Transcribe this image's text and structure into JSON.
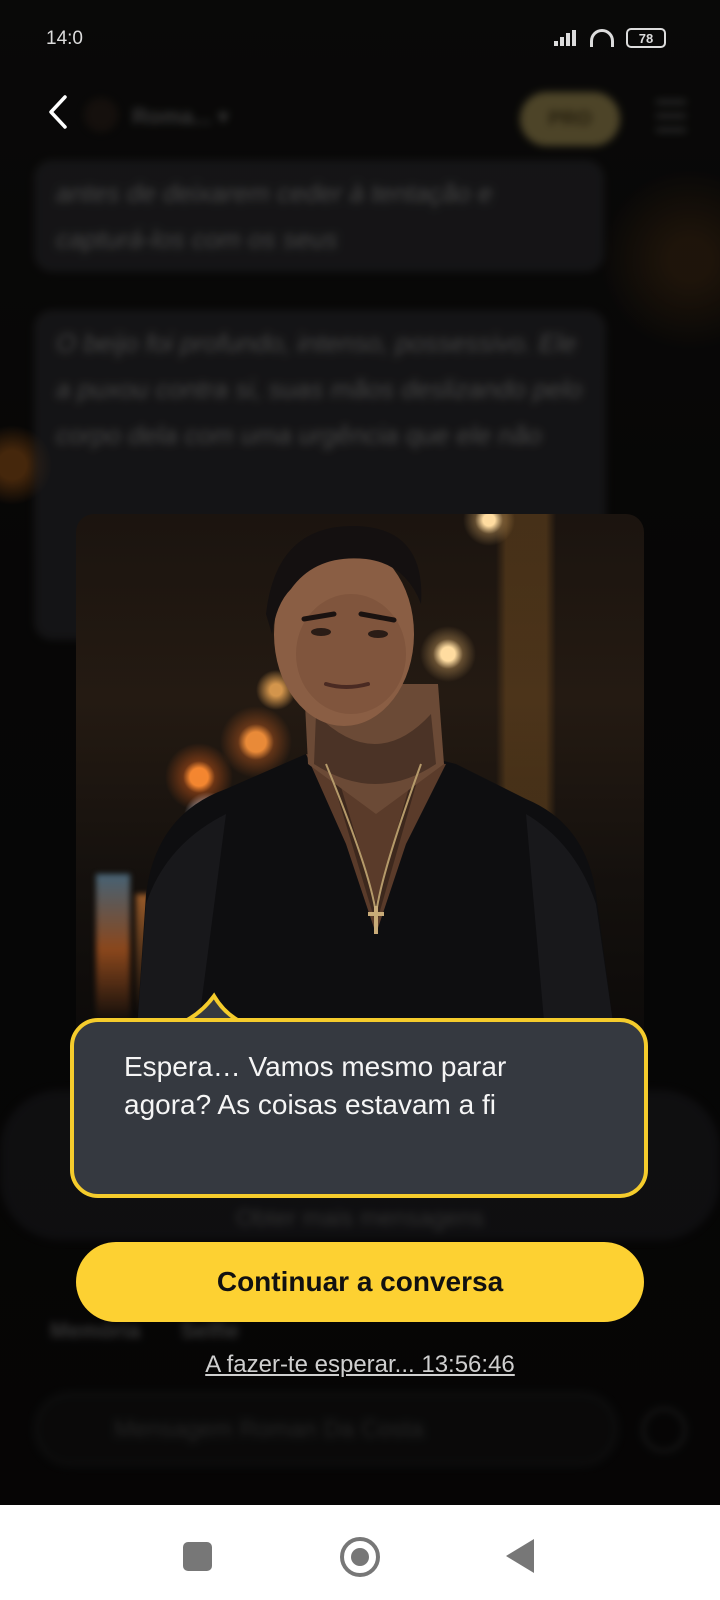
{
  "status_bar": {
    "time": "14:0",
    "battery": "78"
  },
  "background_chat": {
    "character_name": "Roma... ▾",
    "pro_label": "PRO",
    "message_1": "antes de deixarem ceder à tentação e capturá-los com os seus",
    "message_2": "O beijo foi profundo, intenso, possessivo. Ele a puxou contra si, suas mãos deslizando pelo corpo dela com uma urgência que ele não",
    "more_messages_label": "Obter mais mensagens",
    "memory_label": "Memória",
    "selfie_label": "Selfie",
    "input_placeholder": "Mensagem Roman Da Costa"
  },
  "dialog": {
    "bubble_text": "Espera… Vamos mesmo parar\nagora? As coisas estavam a fi",
    "continue_button": "Continuar a conversa",
    "waiting_text": "A fazer-te esperar... 13:56:46"
  },
  "colors": {
    "accent": "#fdd132",
    "bubble_bg": "#353940",
    "bubble_border": "#f5cc2c"
  },
  "icons": {
    "back": "chevron-left-icon",
    "signal": "signal-icon",
    "wifi": "wifi-icon",
    "battery": "battery-icon",
    "nav_recent": "square-icon",
    "nav_home": "circle-icon",
    "nav_back": "triangle-left-icon"
  }
}
